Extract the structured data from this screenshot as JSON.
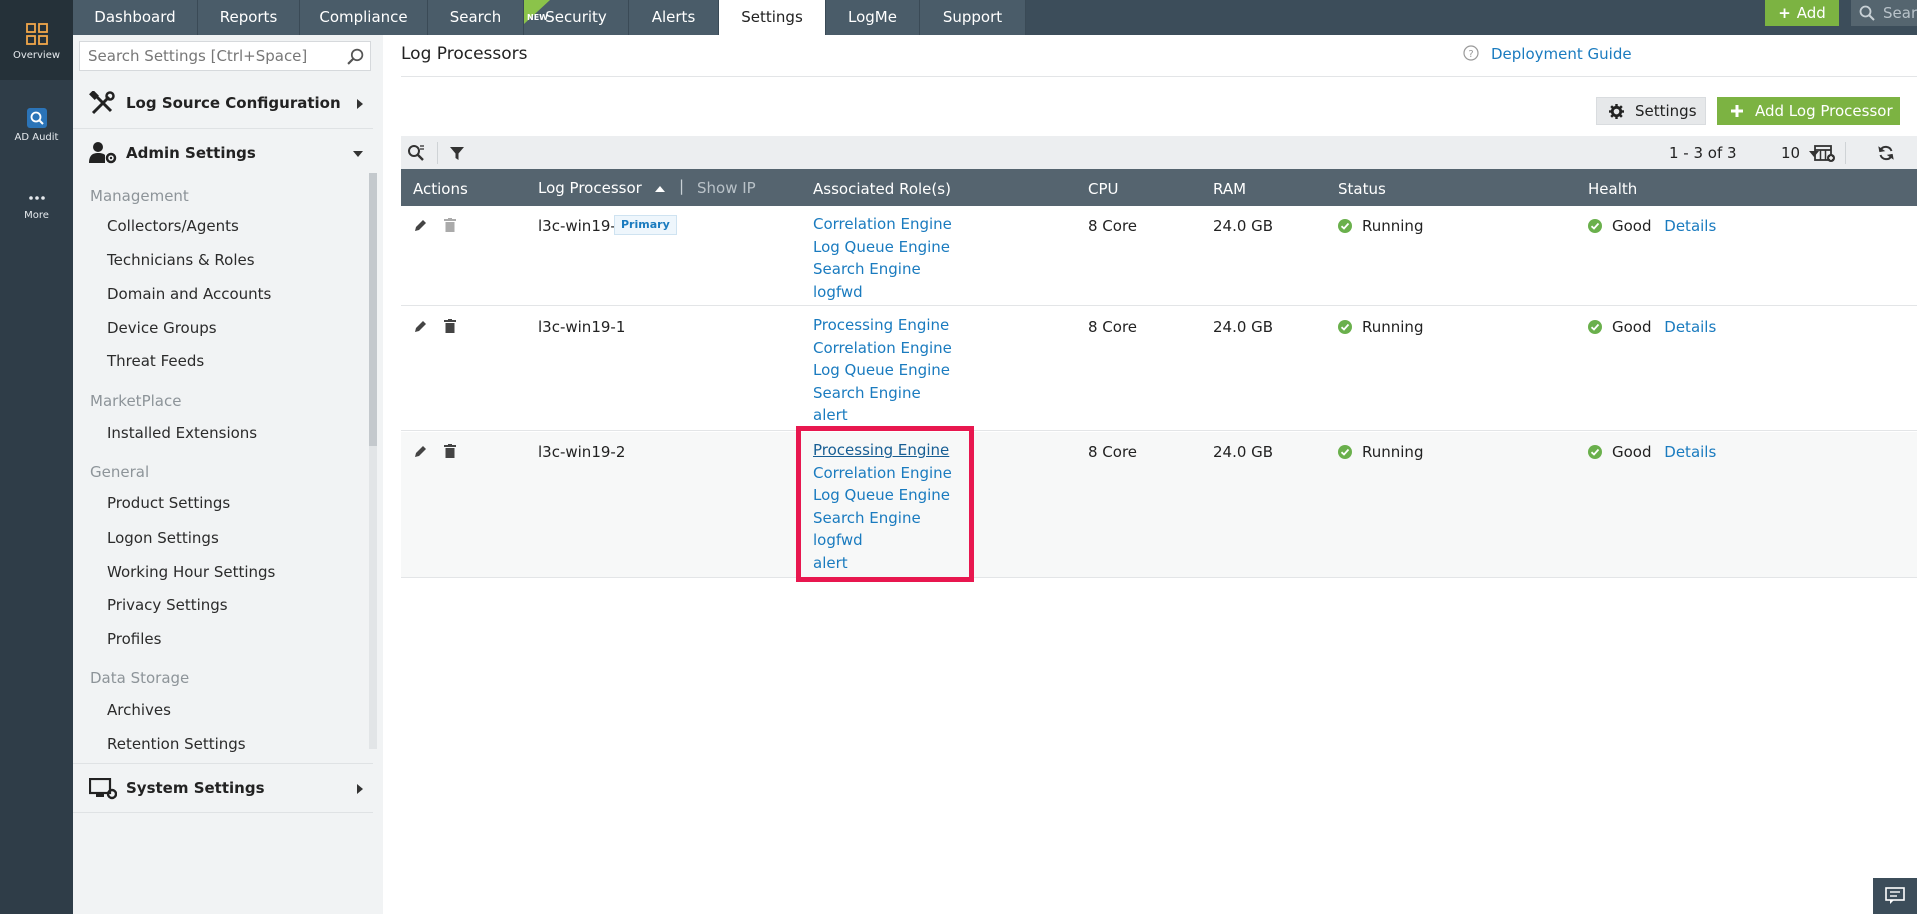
{
  "rail": {
    "items": [
      {
        "label": "Overview",
        "icon": "grid-icon"
      },
      {
        "label": "AD Audit",
        "icon": "ad-audit-icon"
      },
      {
        "label": "More",
        "icon": "more-icon"
      }
    ]
  },
  "nav": {
    "tabs": [
      "Dashboard",
      "Reports",
      "Compliance",
      "Search",
      "Security",
      "Alerts",
      "Settings",
      "LogMe",
      "Support"
    ],
    "new_badge": "NEW",
    "active_tab": "Settings",
    "add_label": "Add",
    "search_placeholder": "Search"
  },
  "sidebar": {
    "search_placeholder": "Search Settings [Ctrl+Space]",
    "sections": {
      "log_source": "Log Source Configuration",
      "admin": "Admin Settings",
      "system": "System Settings"
    },
    "groups": {
      "management": "Management",
      "marketplace": "MarketPlace",
      "general": "General",
      "data_storage": "Data Storage"
    },
    "items": {
      "collectors": "Collectors/Agents",
      "technicians": "Technicians & Roles",
      "domain": "Domain and Accounts",
      "device_groups": "Device Groups",
      "threat_feeds": "Threat Feeds",
      "installed_ext": "Installed Extensions",
      "product_settings": "Product Settings",
      "logon_settings": "Logon Settings",
      "working_hour": "Working Hour Settings",
      "privacy": "Privacy Settings",
      "profiles": "Profiles",
      "archives": "Archives",
      "retention": "Retention Settings"
    }
  },
  "main": {
    "title": "Log Processors",
    "guide": "Deployment Guide",
    "settings_btn": "Settings",
    "add_btn": "Add Log Processor",
    "pager": "1 - 3 of 3",
    "page_size": "10",
    "columns": {
      "actions": "Actions",
      "processor": "Log Processor",
      "show_ip": "Show IP",
      "roles": "Associated Role(s)",
      "cpu": "CPU",
      "ram": "RAM",
      "status": "Status",
      "health": "Health"
    },
    "rows": [
      {
        "name": "l3c-win19-3",
        "badge": "Primary",
        "roles": [
          "Correlation Engine",
          "Log Queue Engine",
          "Search Engine",
          "logfwd"
        ],
        "cpu": "8 Core",
        "ram": "24.0 GB",
        "status": "Running",
        "health": "Good",
        "details": "Details"
      },
      {
        "name": "l3c-win19-1",
        "roles": [
          "Processing Engine",
          "Correlation Engine",
          "Log Queue Engine",
          "Search Engine",
          "alert"
        ],
        "cpu": "8 Core",
        "ram": "24.0 GB",
        "status": "Running",
        "health": "Good",
        "details": "Details"
      },
      {
        "name": "l3c-win19-2",
        "roles": [
          "Processing Engine",
          "Correlation Engine",
          "Log Queue Engine",
          "Search Engine",
          "logfwd",
          "alert"
        ],
        "cpu": "8 Core",
        "ram": "24.0 GB",
        "status": "Running",
        "health": "Good",
        "details": "Details"
      }
    ]
  },
  "colors": {
    "accent_green": "#7cb342",
    "link_blue": "#1a7bbf",
    "highlight": "#e8174f",
    "nav_dark": "#3c4d5a"
  }
}
